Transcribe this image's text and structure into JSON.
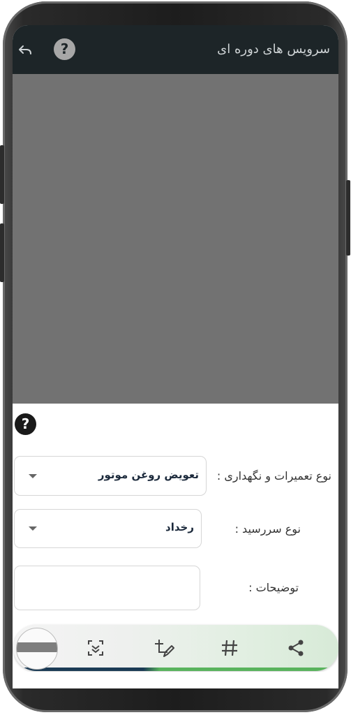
{
  "appbar": {
    "title": "سرویس های دوره ای",
    "help_label": "?"
  },
  "form": {
    "help_label": "?",
    "repair_type": {
      "label": "نوع تعمیرات و نگهداری :",
      "value": "تعویض روغن موتور"
    },
    "due_type": {
      "label": "نوع سررسید :",
      "value": "رخداد"
    },
    "description": {
      "label": "توضیحات :",
      "value": ""
    }
  },
  "toolbar": {
    "icons": [
      "scan-icon",
      "edit-crop-icon",
      "hashtag-icon",
      "share-icon"
    ],
    "accent_colors": [
      "#1b3b55",
      "#59b35d"
    ]
  },
  "colors": {
    "appbar_bg": "#1d2528",
    "overlay": "#727272",
    "value_text": "#1c2a3c"
  }
}
